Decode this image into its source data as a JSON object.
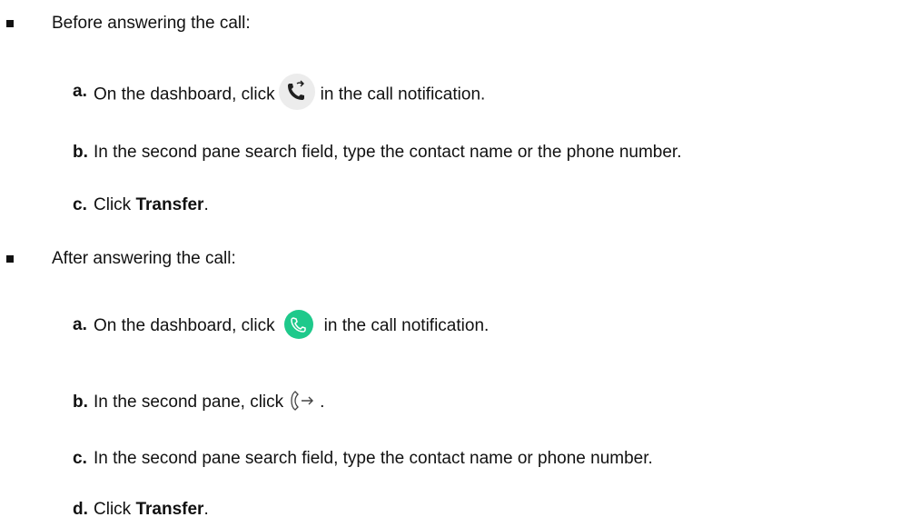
{
  "section1": {
    "heading": "Before answering the call:",
    "steps": [
      {
        "letter": "a.",
        "pre": "On the dashboard, click",
        "post": "in the call notification.",
        "icon": "phone-transfer-icon"
      },
      {
        "letter": "b.",
        "text": "In the second pane search field, type the contact name or the phone number."
      },
      {
        "letter": "c.",
        "pre": "Click",
        "bold": "Transfer",
        "post": "."
      }
    ]
  },
  "section2": {
    "heading": "After answering the call:",
    "steps": [
      {
        "letter": "a.",
        "pre": "On the dashboard, click",
        "post": "in the call notification.",
        "icon": "answer-call-icon",
        "icon_color": "#1ec98b"
      },
      {
        "letter": "b.",
        "pre": "In the second pane, click",
        "post": ".",
        "icon": "transfer-arrow-icon"
      },
      {
        "letter": "c.",
        "text": "In the second pane search field, type the contact name or phone number."
      },
      {
        "letter": "d.",
        "pre": "Click",
        "bold": "Transfer",
        "post": "."
      }
    ]
  }
}
